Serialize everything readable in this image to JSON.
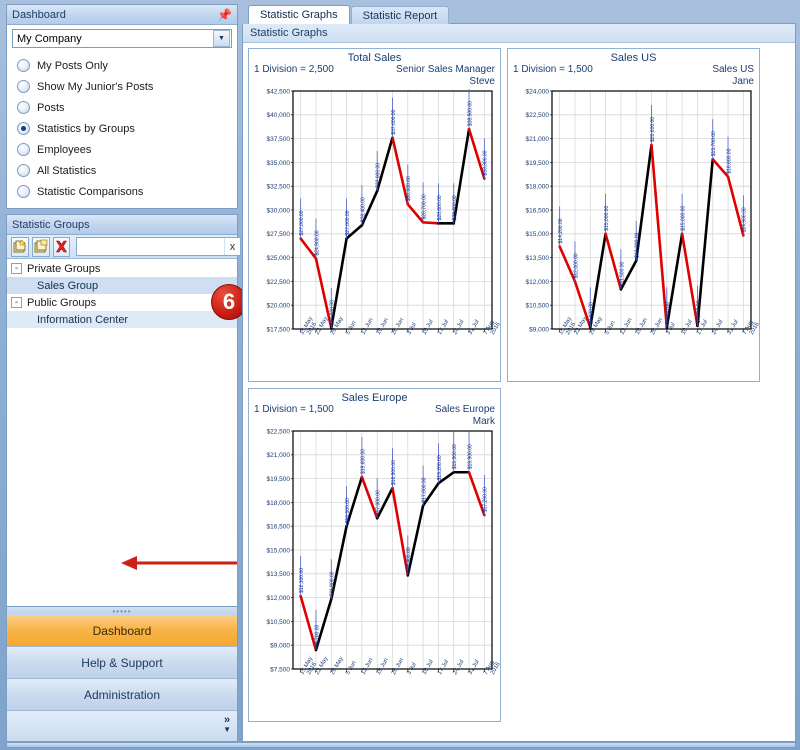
{
  "sidebar": {
    "dashboard_panel": {
      "title": "Dashboard",
      "pin_icon": "pin-icon",
      "company_select": {
        "value": "My Company",
        "arrow_icon": "chevron-down-icon"
      },
      "options": [
        {
          "label": "My Posts Only",
          "selected": false
        },
        {
          "label": "Show My Junior's Posts",
          "selected": false
        },
        {
          "label": "Posts",
          "selected": false
        },
        {
          "label": "Statistics by Groups",
          "selected": true
        },
        {
          "label": "Employees",
          "selected": false
        },
        {
          "label": "All Statistics",
          "selected": false
        },
        {
          "label": "Statistic Comparisons",
          "selected": false
        }
      ]
    },
    "groups_panel": {
      "title": "Statistic Groups",
      "toolbar": {
        "new_group_icon": "new-group-icon",
        "copy_group_icon": "copy-group-icon",
        "delete_icon": "delete-x-icon",
        "search_value": "",
        "search_placeholder": "",
        "clear_label": "x"
      },
      "tree": [
        {
          "type": "group",
          "label": "Private Groups",
          "expander": "-"
        },
        {
          "type": "leaf",
          "label": "Sales Group",
          "selected": true
        },
        {
          "type": "group",
          "label": "Public Groups",
          "expander": "-"
        },
        {
          "type": "leaf",
          "label": "Information Center",
          "selected": false
        }
      ]
    },
    "annotation": {
      "badge_number": "6",
      "arrow_icon": "left-arrow-annotation"
    },
    "nav": [
      {
        "label": "Dashboard",
        "active": true
      },
      {
        "label": "Help & Support",
        "active": false
      },
      {
        "label": "Administration",
        "active": false
      }
    ],
    "nav_expand_icon": "chevron-double-right-icon"
  },
  "main": {
    "tabs": [
      {
        "label": "Statistic Graphs",
        "active": true
      },
      {
        "label": "Statistic Report",
        "active": false
      }
    ],
    "content_header": "Statistic Graphs"
  },
  "colors": {
    "line_up": "#000000",
    "line_down": "#e00000",
    "label_text": "#11318f",
    "axis_text": "#1b3e72",
    "accent_orange": "#f5a72f",
    "badge_red": "#cc1f16"
  },
  "chart_data": [
    {
      "type": "line",
      "title": "Total Sales",
      "division_note": "1 Division = 2,500",
      "owner_role": "Senior Sales Manager",
      "owner_name": "Steve",
      "xlabel": "",
      "ylabel": "",
      "ylim": [
        17500,
        42500
      ],
      "ytick_step": 2500,
      "ytick_labels": [
        "$17,500",
        "$20,000",
        "$22,500",
        "$25,000",
        "$27,500",
        "$30,000",
        "$32,500",
        "$35,000",
        "$37,500",
        "$40,000",
        "$42,500"
      ],
      "grid": true,
      "categories": [
        "15 May 2016",
        "22 May",
        "29 May",
        "5 Jun",
        "12 Jun",
        "19 Jun",
        "26 Jun",
        "3 Jul",
        "10 Jul",
        "17 Jul",
        "24 Jul",
        "31 Jul",
        "7 Aug 2016"
      ],
      "values": [
        27000,
        24900,
        17600,
        27000,
        28400,
        32000,
        37600,
        30600,
        28700,
        28600,
        28600,
        38500,
        33300
      ],
      "point_labels": [
        "$27,000.00",
        "$24,900.00",
        "$17,600.00",
        "$27,000.00",
        "$28,400.00",
        "$32,000.00",
        "$37,600.00",
        "$30,600.00",
        "$28,700.00",
        "$28,600.00",
        "$28,600.00",
        "$38,500.00",
        "$33,300.00"
      ]
    },
    {
      "type": "line",
      "title": "Sales US",
      "division_note": "1 Division = 1,500",
      "owner_role": "Sales US",
      "owner_name": "Jane",
      "xlabel": "",
      "ylabel": "",
      "ylim": [
        9000,
        24000
      ],
      "ytick_step": 1500,
      "ytick_labels": [
        "$9,000",
        "$10,500",
        "$12,000",
        "$13,500",
        "$15,000",
        "$16,500",
        "$18,000",
        "$19,500",
        "$21,000",
        "$22,500",
        "$24,000"
      ],
      "grid": true,
      "categories": [
        "15 May 2016",
        "22 May",
        "29 May",
        "5 Jun",
        "12 Jun",
        "19 Jun",
        "26 Jun",
        "3 Jul",
        "10 Jul",
        "17 Jul",
        "24 Jul",
        "31 Jul",
        "7 Aug 2016"
      ],
      "values": [
        14200,
        12000,
        9100,
        15000,
        11500,
        13300,
        20600,
        9100,
        15000,
        9200,
        19700,
        18600,
        14900
      ],
      "point_labels": [
        "$14,200.00",
        "$12,000.00",
        "$9,100.00",
        "$15,000.00",
        "$11,500.00",
        "$13,300.00",
        "$20,600.00",
        "$9,100.00",
        "$15,000.00",
        "$9,200.00",
        "$19,700.00",
        "$18,600.00",
        "$14,900.00"
      ]
    },
    {
      "type": "line",
      "title": "Sales Europe",
      "division_note": "1 Division = 1,500",
      "owner_role": "Sales Europe",
      "owner_name": "Mark",
      "xlabel": "",
      "ylabel": "",
      "ylim": [
        7500,
        22500
      ],
      "ytick_step": 1500,
      "ytick_labels": [
        "$7,500",
        "$9,000",
        "$10,500",
        "$12,000",
        "$13,500",
        "$15,000",
        "$16,500",
        "$18,000",
        "$19,500",
        "$21,000",
        "$22,500"
      ],
      "grid": true,
      "categories": [
        "15 May 2016",
        "22 May",
        "29 May",
        "5 Jun",
        "12 Jun",
        "19 Jun",
        "26 Jun",
        "3 Jul",
        "10 Jul",
        "17 Jul",
        "24 Jul",
        "31 Jul",
        "7 Aug 2016"
      ],
      "values": [
        12100,
        8700,
        11900,
        16500,
        19600,
        17000,
        18900,
        13400,
        17800,
        19200,
        19900,
        19900,
        17200
      ],
      "point_labels": [
        "$12,100.00",
        "$8,700.00",
        "$11,900.00",
        "$16,500.00",
        "$19,600.00",
        "$17,000.00",
        "$18,900.00",
        "$13,400.00",
        "$17,800.00",
        "$19,200.00",
        "$19,900.00",
        "$19,900.00",
        "$17,200.00"
      ]
    }
  ]
}
